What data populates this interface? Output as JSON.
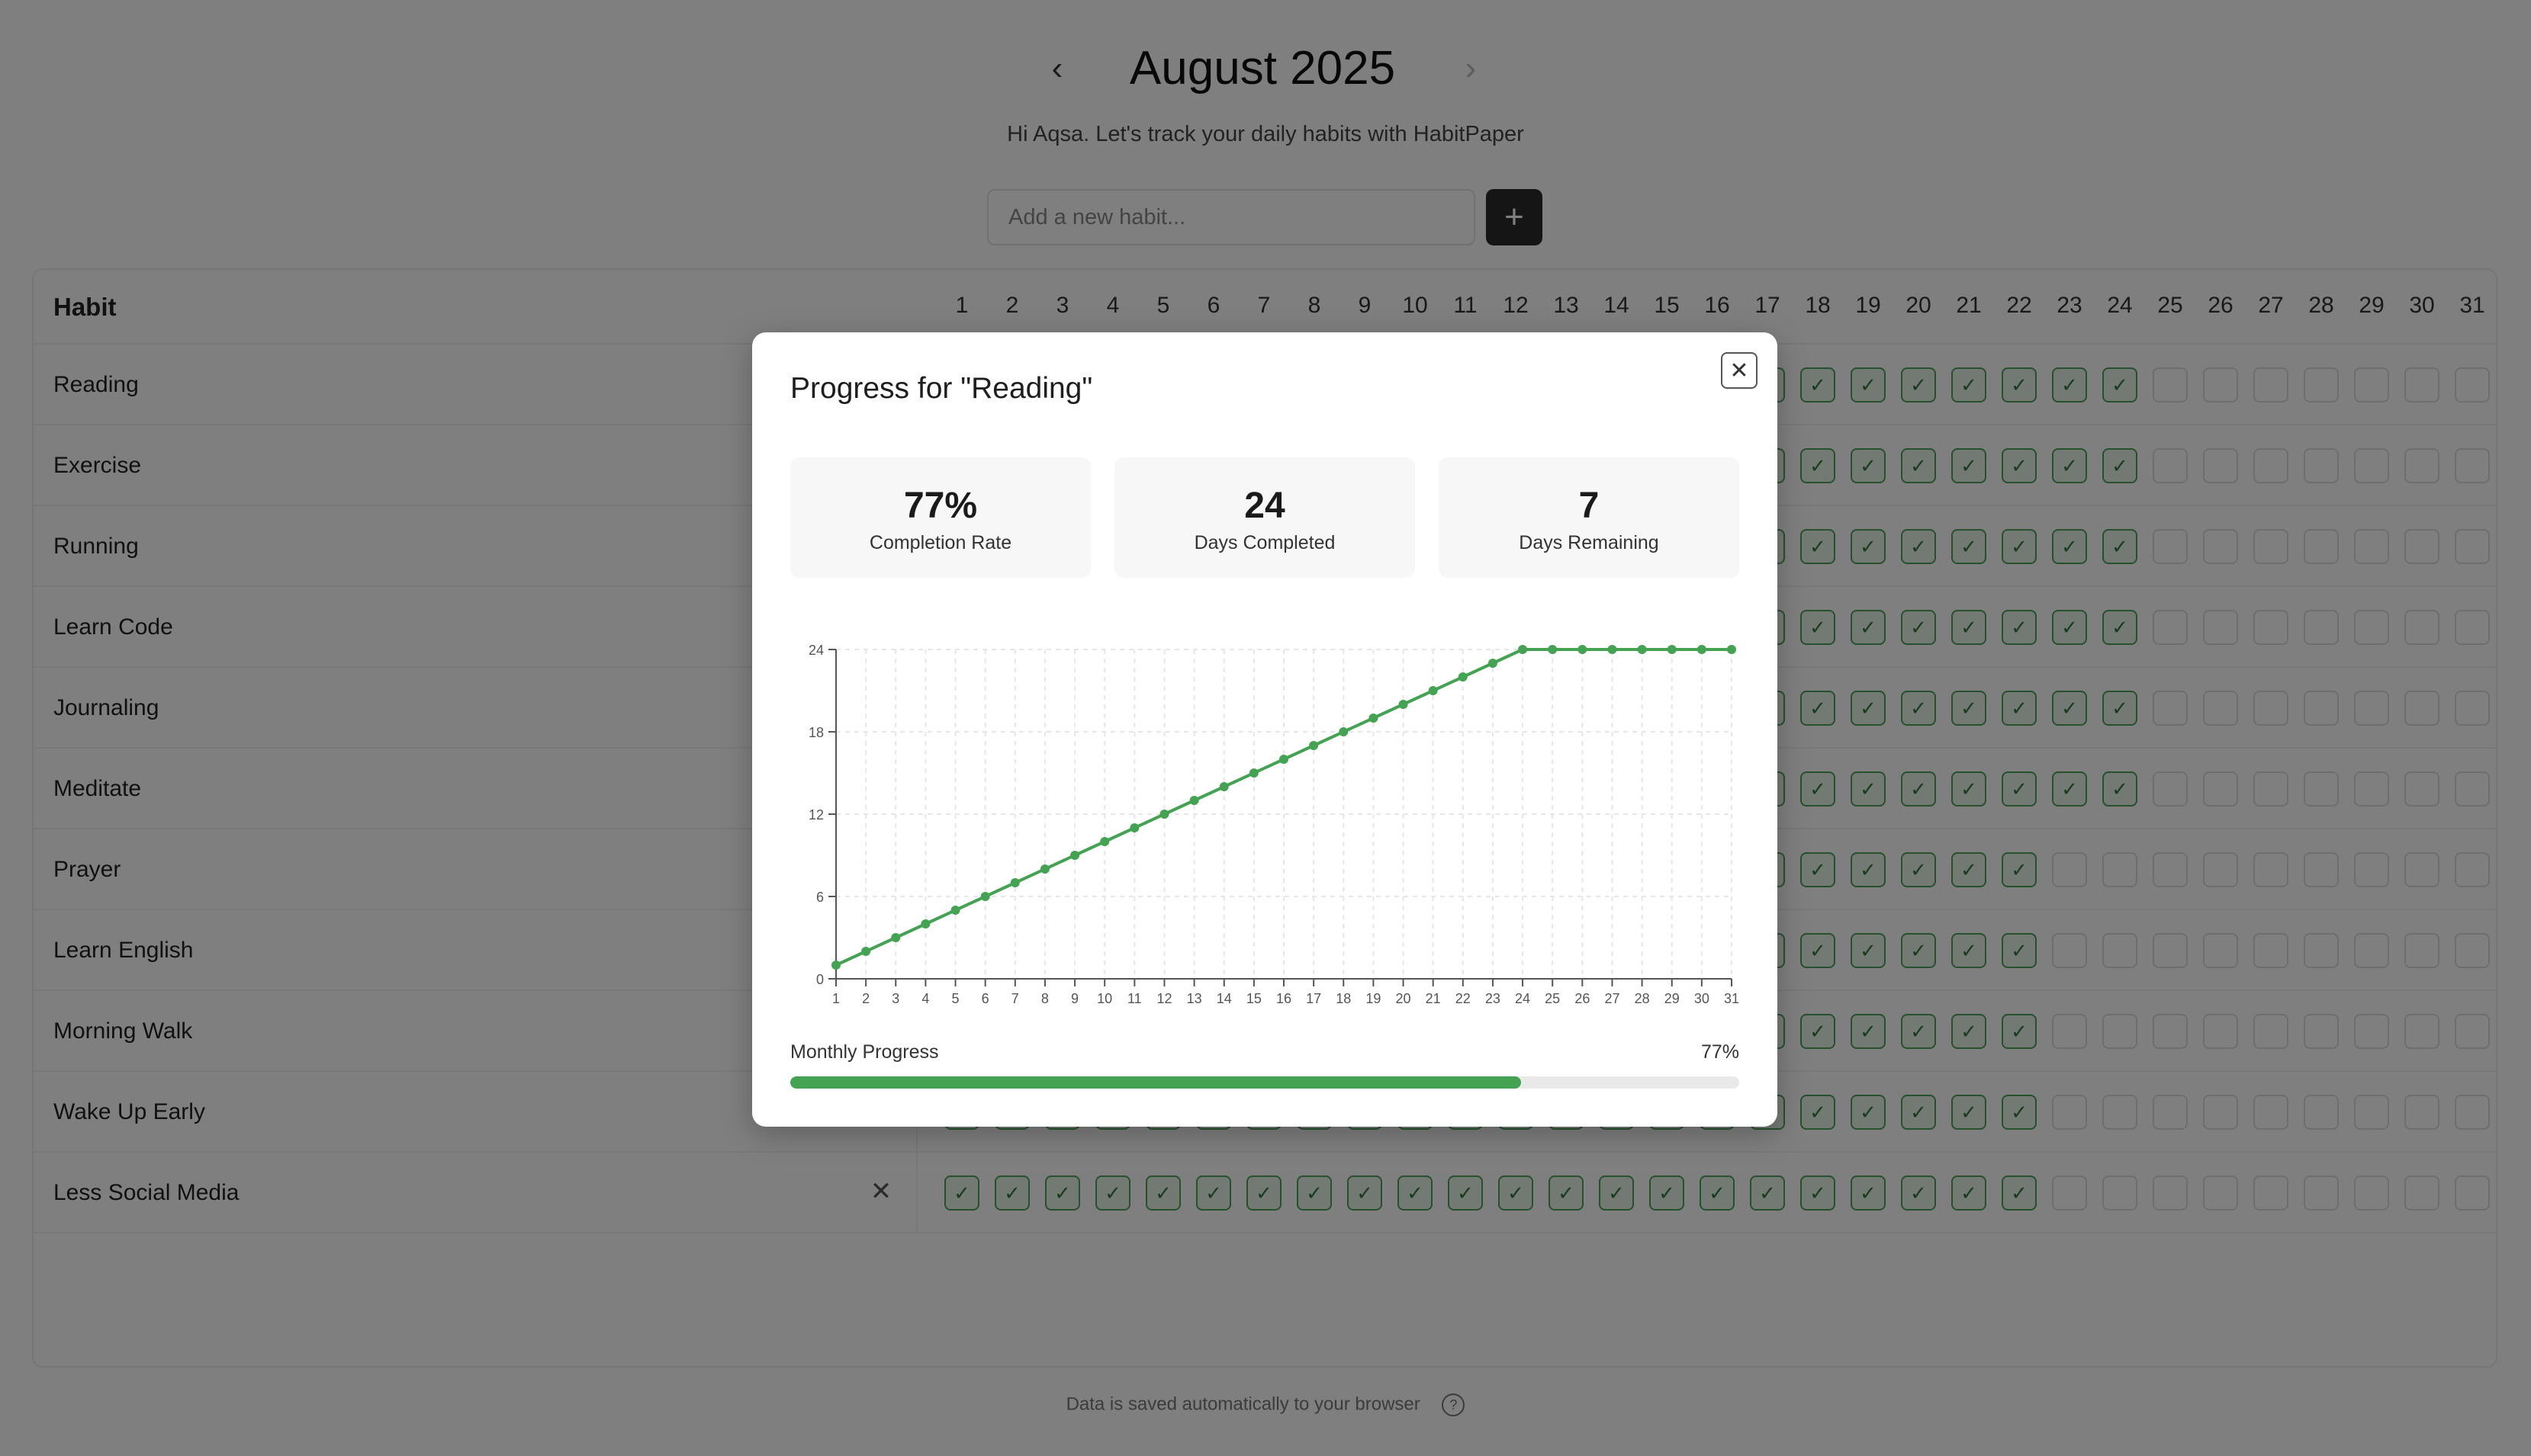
{
  "header": {
    "month_title": "August 2025",
    "prev_icon": "chevron-left-icon",
    "next_icon": "chevron-right-icon",
    "greeting": "Hi Aqsa. Let's track your daily habits with HabitPaper",
    "add_placeholder": "Add a new habit...",
    "add_icon": "plus-icon"
  },
  "table": {
    "habit_header": "Habit",
    "days": [
      "1",
      "2",
      "3",
      "4",
      "5",
      "6",
      "7",
      "8",
      "9",
      "10",
      "11",
      "12",
      "13",
      "14",
      "15",
      "16",
      "17",
      "18",
      "19",
      "20",
      "21",
      "22",
      "23",
      "24",
      "25",
      "26",
      "27",
      "28",
      "29",
      "30",
      "31"
    ],
    "rows": [
      {
        "name": "Reading",
        "done_through": 24
      },
      {
        "name": "Exercise",
        "done_through": 24
      },
      {
        "name": "Running",
        "done_through": 24
      },
      {
        "name": "Learn Code",
        "done_through": 24
      },
      {
        "name": "Journaling",
        "done_through": 24
      },
      {
        "name": "Meditate",
        "done_through": 24
      },
      {
        "name": "Prayer",
        "done_through": 22
      },
      {
        "name": "Learn English",
        "done_through": 22
      },
      {
        "name": "Morning Walk",
        "done_through": 22
      },
      {
        "name": "Wake Up Early",
        "done_through": 22
      },
      {
        "name": "Less Social Media",
        "done_through": 22,
        "show_remove": true
      }
    ],
    "remove_icon": "close-icon",
    "check_icon": "check-icon"
  },
  "footer": {
    "note": "Data is saved automatically to your browser",
    "help_icon": "question-circle-icon"
  },
  "modal": {
    "title": "Progress for \"Reading\"",
    "close_icon": "close-icon",
    "stats": [
      {
        "value": "77%",
        "label": "Completion Rate"
      },
      {
        "value": "24",
        "label": "Days Completed"
      },
      {
        "value": "7",
        "label": "Days Remaining"
      }
    ],
    "progress_label": "Monthly Progress",
    "progress_text": "77%",
    "progress_value": 0.77,
    "accent_color": "#43a352"
  },
  "chart_data": {
    "type": "line",
    "x": [
      1,
      2,
      3,
      4,
      5,
      6,
      7,
      8,
      9,
      10,
      11,
      12,
      13,
      14,
      15,
      16,
      17,
      18,
      19,
      20,
      21,
      22,
      23,
      24,
      25,
      26,
      27,
      28,
      29,
      30,
      31
    ],
    "series": [
      {
        "values": [
          1,
          2,
          3,
          4,
          5,
          6,
          7,
          8,
          9,
          10,
          11,
          12,
          13,
          14,
          15,
          16,
          17,
          18,
          19,
          20,
          21,
          22,
          23,
          24,
          24,
          24,
          24,
          24,
          24,
          24,
          24
        ]
      }
    ],
    "y_ticks": [
      0,
      6,
      12,
      18,
      24
    ],
    "ylim": [
      0,
      24
    ],
    "xlim": [
      1,
      31
    ],
    "grid": true,
    "line_color": "#43a352"
  }
}
